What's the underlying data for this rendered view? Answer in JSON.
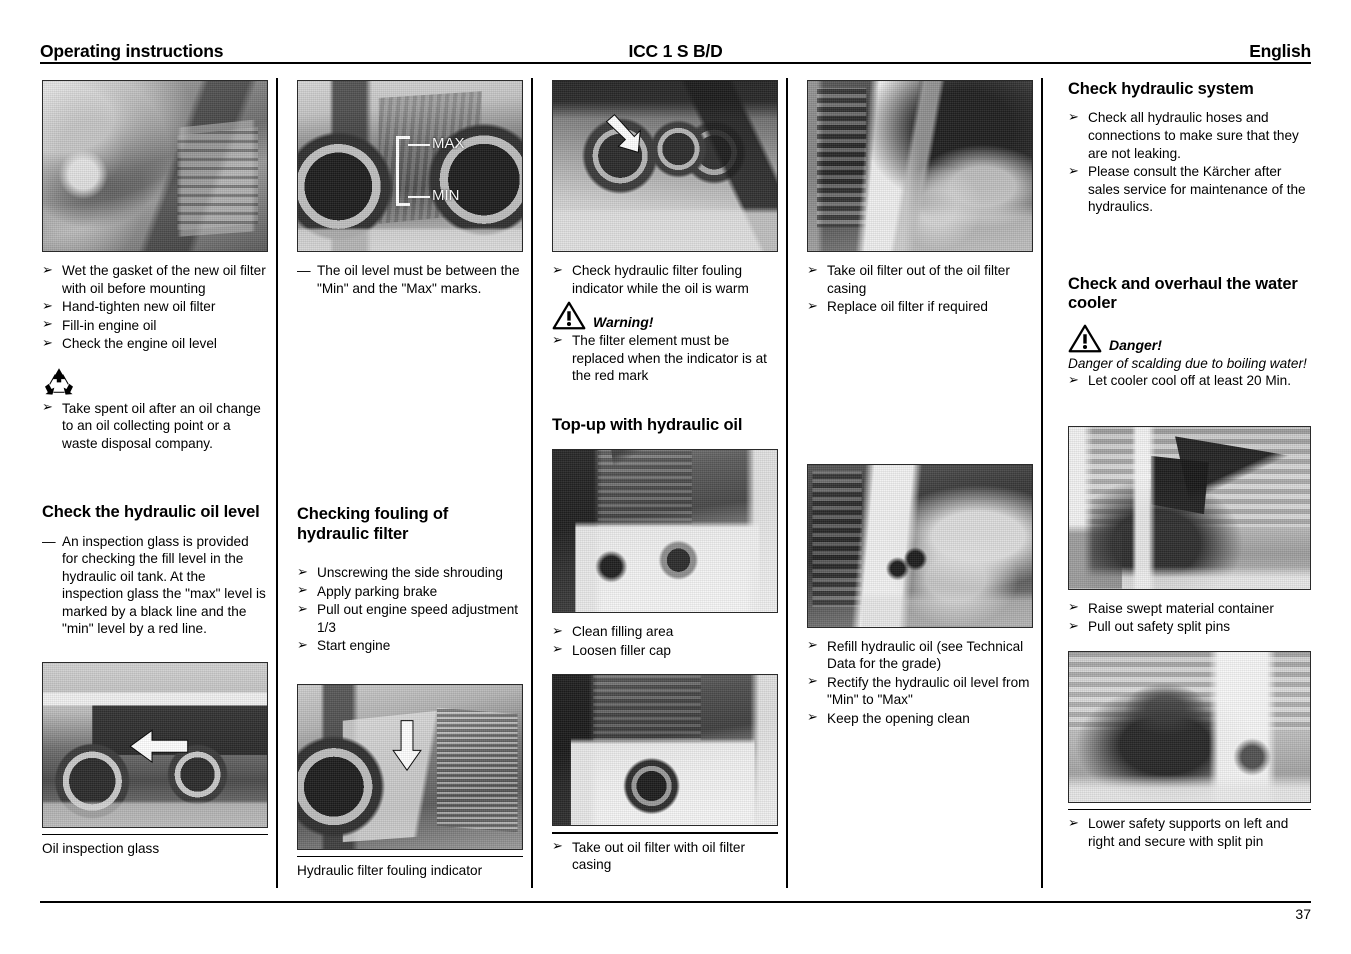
{
  "header": {
    "left": "Operating instructions",
    "center": "ICC 1 S B/D",
    "right": "English"
  },
  "footer": {
    "page_number": "37"
  },
  "markers": {
    "bullet": "➢",
    "dash": "—"
  },
  "columns": [
    {
      "id": "column-1",
      "blocks": [
        {
          "type": "photo",
          "name": "photo-oil-filter-mounting",
          "caption": null
        },
        {
          "type": "bullets",
          "name": "oil-filter-steps",
          "items": [
            "Wet the gasket of the new oil filter with oil before mounting",
            "Hand-tighten new oil filter",
            "Fill-in engine oil",
            "Check the engine oil level"
          ]
        },
        {
          "type": "icon",
          "name": "recycle-icon"
        },
        {
          "type": "bullets",
          "name": "spent-oil-disposal",
          "items": [
            "Take spent oil after an oil change to an oil collecting point or a waste disposal company."
          ]
        },
        {
          "type": "heading",
          "name": "heading-check-hydraulic-oil-level",
          "text": "Check the hydraulic oil level"
        },
        {
          "type": "dash",
          "name": "inspection-glass-note",
          "text": "An inspection glass is provided for checking the fill level in the hydraulic oil tank. At the inspection glass the \"max\" level is marked by a black line and the \"min\" level by a red line."
        },
        {
          "type": "photo",
          "name": "photo-oil-inspection-glass",
          "caption": "Oil inspection glass"
        }
      ]
    },
    {
      "id": "column-2",
      "blocks": [
        {
          "type": "photo",
          "name": "photo-dipstick-max-min",
          "labels": [
            "MAX",
            "MIN"
          ],
          "caption": null
        },
        {
          "type": "dash",
          "name": "oil-level-note",
          "text": "The oil level must be between the \"Min\" and the \"Max\" marks."
        },
        {
          "type": "heading",
          "name": "heading-checking-fouling-hydraulic-filter",
          "text": "Checking fouling of hydraulic filter"
        },
        {
          "type": "bullets",
          "name": "fouling-check-steps",
          "items": [
            "Unscrewing the side shrouding",
            "Apply parking brake",
            "Pull out engine speed adjustment 1/3",
            "Start engine"
          ]
        },
        {
          "type": "photo",
          "name": "photo-hydraulic-filter-fouling-indicator",
          "caption": "Hydraulic filter fouling indicator"
        }
      ]
    },
    {
      "id": "column-3",
      "blocks": [
        {
          "type": "photo",
          "name": "photo-fouling-indicator-closeup",
          "caption": null
        },
        {
          "type": "bullets",
          "name": "check-fouling-indicator",
          "items": [
            "Check hydraulic filter fouling indicator while the oil is warm"
          ]
        },
        {
          "type": "notice",
          "name": "warning-notice",
          "label": "Warning!",
          "icon": "warning-triangle-icon"
        },
        {
          "type": "bullets",
          "name": "filter-element-replacement",
          "items": [
            "The filter element must be replaced when the indicator is at the red mark"
          ]
        },
        {
          "type": "heading",
          "name": "heading-top-up-hydraulic-oil",
          "text": "Top-up with hydraulic oil"
        },
        {
          "type": "photo",
          "name": "photo-filler-cap-area",
          "caption": null
        },
        {
          "type": "bullets",
          "name": "filling-area-steps",
          "items": [
            "Clean filling area",
            "Loosen filler cap"
          ]
        },
        {
          "type": "photo",
          "name": "photo-oil-filter-casing",
          "caption": null
        },
        {
          "type": "bullets",
          "name": "take-out-oil-filter",
          "items": [
            "Take out oil filter with oil filter casing"
          ]
        }
      ]
    },
    {
      "id": "column-4",
      "blocks": [
        {
          "type": "photo",
          "name": "photo-remove-oil-filter",
          "caption": null
        },
        {
          "type": "bullets",
          "name": "oil-filter-removal-steps",
          "items": [
            "Take oil filter out of the oil filter casing",
            "Replace oil filter if required"
          ]
        },
        {
          "type": "photo",
          "name": "photo-refill-hydraulic-oil",
          "caption": null
        },
        {
          "type": "bullets",
          "name": "refill-steps",
          "items": [
            "Refill hydraulic oil (see Technical Data for the grade)",
            "Rectify the hydraulic oil level from \"Min\" to \"Max\"",
            "Keep the opening clean"
          ]
        }
      ]
    },
    {
      "id": "column-5",
      "blocks": [
        {
          "type": "heading",
          "name": "heading-check-hydraulic-system",
          "text": "Check hydraulic system"
        },
        {
          "type": "bullets",
          "name": "hydraulic-system-checks",
          "items": [
            "Check all hydraulic hoses and connections to make sure that they are not leaking.",
            "Please consult the Kärcher after sales service for maintenance of the hydraulics."
          ]
        },
        {
          "type": "heading",
          "name": "heading-check-overhaul-water-cooler",
          "text": "Check and overhaul the water cooler"
        },
        {
          "type": "notice",
          "name": "danger-notice",
          "label": "Danger!",
          "icon": "warning-triangle-icon",
          "body": "Danger of scalding due to boiling water!"
        },
        {
          "type": "bullets",
          "name": "cooler-cooloff-step",
          "items": [
            "Let cooler cool off at least 20 Min."
          ]
        },
        {
          "type": "photo",
          "name": "photo-raise-swept-material-container",
          "caption": null
        },
        {
          "type": "bullets",
          "name": "raise-container-steps",
          "items": [
            "Raise swept material container",
            "Pull out safety split pins"
          ]
        },
        {
          "type": "photo",
          "name": "photo-lower-safety-supports",
          "caption": null
        },
        {
          "type": "bullets",
          "name": "lower-supports-step",
          "items": [
            "Lower safety supports on left and right and secure with split pin"
          ]
        }
      ]
    }
  ]
}
